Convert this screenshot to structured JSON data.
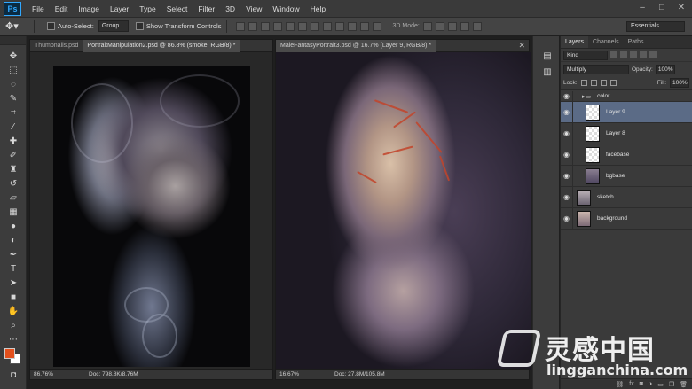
{
  "app": {
    "logo_text": "Ps",
    "menu": [
      "File",
      "Edit",
      "Image",
      "Layer",
      "Type",
      "Select",
      "Filter",
      "3D",
      "View",
      "Window",
      "Help"
    ],
    "window_controls": [
      "–",
      "□",
      "✕"
    ]
  },
  "options_bar": {
    "auto_select_label": "Auto-Select:",
    "auto_select_value": "Group",
    "transform_label": "Show Transform Controls",
    "mode_3d_label": "3D Mode:",
    "workspace": "Essentials"
  },
  "colors": {
    "foreground": "#e3501d",
    "background": "#ffffff",
    "selection": "#5b6b86"
  },
  "doc1": {
    "tabs": [
      "Thumbnails.psd",
      "PortraitManipulation2.psd @ 86.8% (smoke, RGB/8) *"
    ],
    "title": "PortraitManipulation2.psd @ 86.8% (smoke, RGB/8) *",
    "zoom": "86.76%",
    "doc_info": "Doc: 798.8K/8.76M"
  },
  "doc2": {
    "title": "MaleFantasyPortrait3.psd @ 16.7% (Layer 9, RGB/8) *",
    "zoom": "16.67%",
    "doc_info": "Doc: 27.8M/105.8M"
  },
  "layers_panel": {
    "tabs": [
      "Layers",
      "Channels",
      "Paths"
    ],
    "kind": "Kind",
    "blend_mode": "Multiply",
    "opacity_label": "Opacity:",
    "opacity_value": "100%",
    "lock_label": "Lock:",
    "fill_label": "Fill:",
    "fill_value": "100%",
    "layers": [
      {
        "name": "color",
        "type": "group"
      },
      {
        "name": "Layer 9",
        "type": "empty",
        "selected": true
      },
      {
        "name": "Layer 8",
        "type": "empty"
      },
      {
        "name": "facebase",
        "type": "empty"
      },
      {
        "name": "bgbase",
        "type": "image"
      },
      {
        "name": "sketch",
        "type": "image"
      },
      {
        "name": "background",
        "type": "image"
      }
    ],
    "bottom_icons": [
      "link-icon",
      "fx-icon",
      "mask-icon",
      "adjustment-icon",
      "folder-icon",
      "new-layer-icon",
      "trash-icon"
    ]
  },
  "watermark": {
    "cn": "灵感中国",
    "en": "lingganchina.com"
  }
}
